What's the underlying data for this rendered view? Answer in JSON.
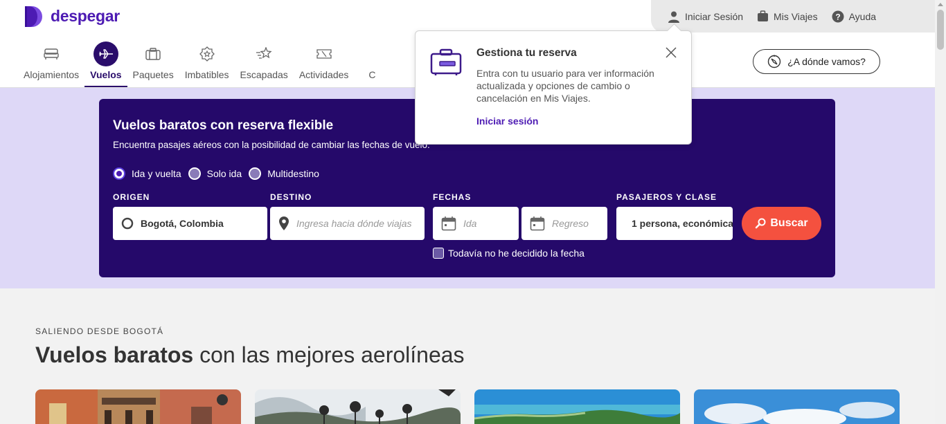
{
  "brand": {
    "name": "despegar",
    "color": "#4d1bb3"
  },
  "userbar": {
    "login": "Iniciar Sesión",
    "trips": "Mis Viajes",
    "help": "Ayuda"
  },
  "nav": {
    "items": [
      {
        "label": "Alojamientos",
        "icon": "bed-icon"
      },
      {
        "label": "Vuelos",
        "icon": "airplane-icon",
        "active": true
      },
      {
        "label": "Paquetes",
        "icon": "suitcase-icon"
      },
      {
        "label": "Imbatibles",
        "icon": "star-badge-icon"
      },
      {
        "label": "Escapadas",
        "icon": "shooting-star-icon"
      },
      {
        "label": "Actividades",
        "icon": "ticket-icon"
      },
      {
        "label": "C",
        "icon": ""
      }
    ]
  },
  "where_button": "¿A dónde vamos?",
  "popover": {
    "title": "Gestiona tu reserva",
    "text": "Entra con tu usuario para ver información actualizada y opciones de cambio o cancelación en Mis Viajes.",
    "link": "Iniciar sesión"
  },
  "search": {
    "title": "Vuelos baratos con reserva flexible",
    "subtitle": "Encuentra pasajes aéreos con la posibilidad de cambiar las fechas de vuelo.",
    "trip_types": [
      "Ida y vuelta",
      "Solo ida",
      "Multidestino"
    ],
    "selected_trip_type": "Ida y vuelta",
    "origin_label": "ORIGEN",
    "origin_value": "Bogotá, Colombia",
    "destination_label": "DESTINO",
    "destination_placeholder": "Ingresa hacia dónde viajas",
    "dates_label": "FECHAS",
    "departure_placeholder": "Ida",
    "return_placeholder": "Regreso",
    "passengers_label": "PASAJEROS Y CLASE",
    "passengers_value": "1 persona, económica",
    "search_button": "Buscar",
    "undecided_label": "Todavía no he decidido la fecha"
  },
  "section": {
    "kicker": "SALIENDO DESDE BOGOTÁ",
    "title_bold": "Vuelos baratos",
    "title_rest": " con las mejores aerolíneas"
  }
}
